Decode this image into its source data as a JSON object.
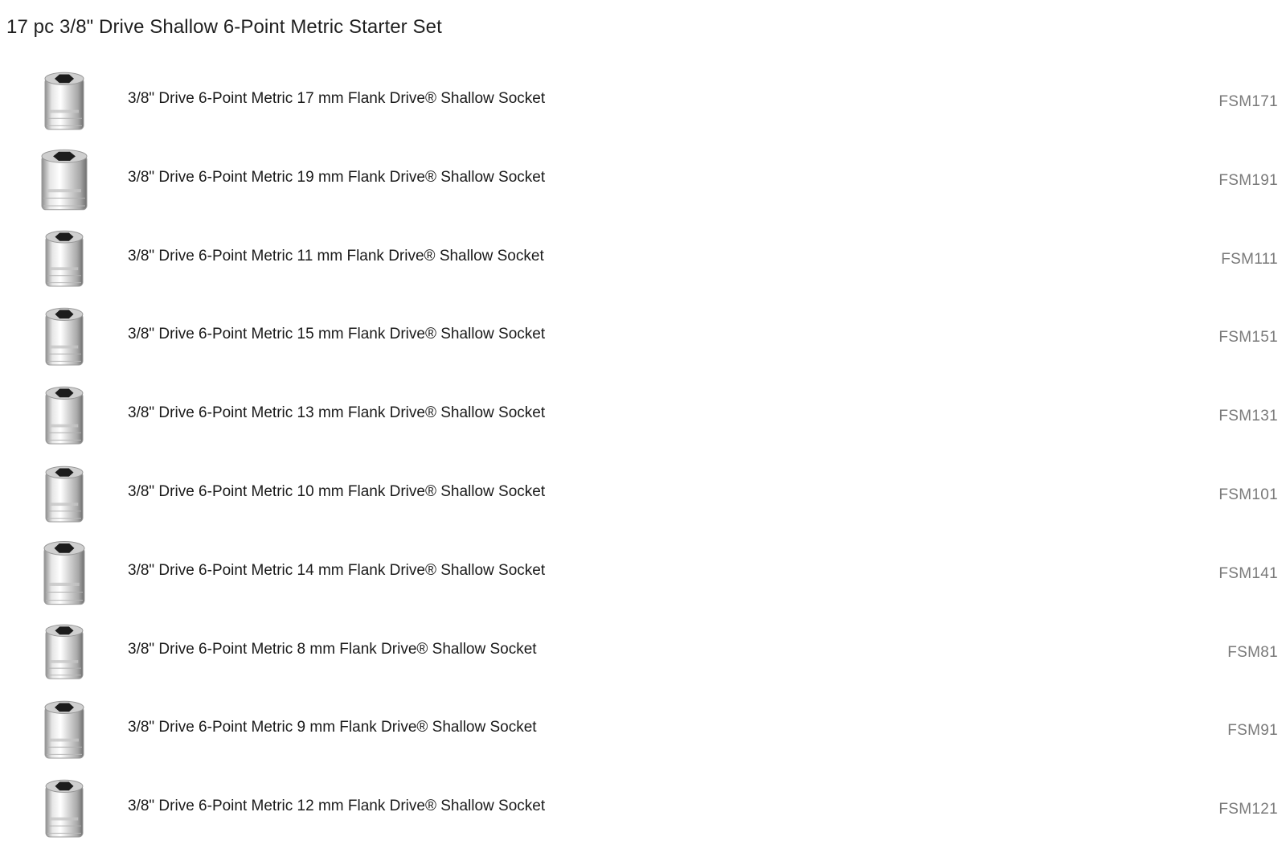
{
  "page": {
    "title": "17 pc 3/8\" Drive Shallow 6-Point Metric Starter Set"
  },
  "items": [
    {
      "description": "3/8\" Drive 6-Point Metric 17 mm Flank Drive® Shallow Socket",
      "sku": "FSM171",
      "icon": "socket-icon"
    },
    {
      "description": "3/8\" Drive 6-Point Metric 19 mm Flank Drive® Shallow Socket",
      "sku": "FSM191",
      "icon": "socket-icon"
    },
    {
      "description": "3/8\" Drive 6-Point Metric 11 mm Flank Drive® Shallow Socket",
      "sku": "FSM111",
      "icon": "socket-icon"
    },
    {
      "description": "3/8\" Drive 6-Point Metric 15 mm Flank Drive® Shallow Socket",
      "sku": "FSM151",
      "icon": "socket-icon"
    },
    {
      "description": "3/8\" Drive 6-Point Metric 13 mm Flank Drive® Shallow Socket",
      "sku": "FSM131",
      "icon": "socket-icon"
    },
    {
      "description": "3/8\" Drive 6-Point Metric 10 mm Flank Drive® Shallow Socket",
      "sku": "FSM101",
      "icon": "socket-icon"
    },
    {
      "description": "3/8\" Drive 6-Point Metric 14 mm Flank Drive® Shallow Socket",
      "sku": "FSM141",
      "icon": "socket-icon"
    },
    {
      "description": "3/8\" Drive 6-Point Metric 8 mm Flank Drive® Shallow Socket",
      "sku": "FSM81",
      "icon": "socket-icon"
    },
    {
      "description": "3/8\" Drive 6-Point Metric 9 mm Flank Drive® Shallow Socket",
      "sku": "FSM91",
      "icon": "socket-icon"
    },
    {
      "description": "3/8\" Drive 6-Point Metric 12 mm Flank Drive® Shallow Socket",
      "sku": "FSM121",
      "icon": "socket-icon"
    }
  ],
  "colors": {
    "text": "#1a1a1a",
    "sku_text": "#7a7a7a",
    "background": "#ffffff"
  }
}
